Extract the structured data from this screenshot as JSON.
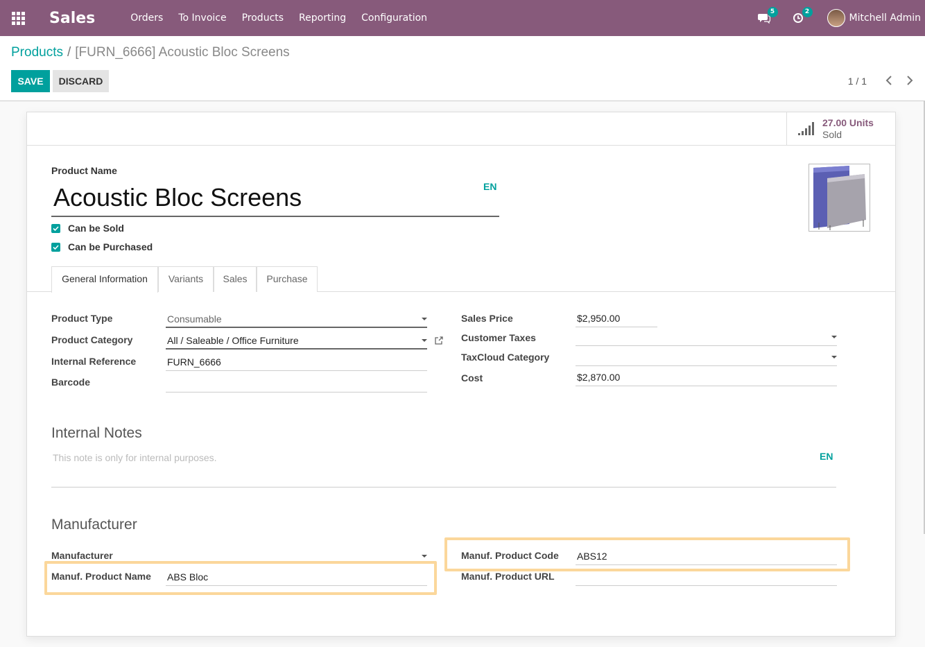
{
  "navbar": {
    "app_name": "Sales",
    "menu": [
      "Orders",
      "To Invoice",
      "Products",
      "Reporting",
      "Configuration"
    ],
    "messages_count": "5",
    "activities_count": "2",
    "user_name": "Mitchell Admin"
  },
  "breadcrumb": {
    "parent": "Products",
    "separator": "/",
    "current": "[FURN_6666] Acoustic Bloc Screens"
  },
  "toolbar": {
    "save_label": "SAVE",
    "discard_label": "DISCARD",
    "pager": "1 / 1"
  },
  "stat": {
    "value": "27.00 Units",
    "label": "Sold"
  },
  "product": {
    "name_label": "Product Name",
    "name": "Acoustic Bloc Screens",
    "lang": "EN",
    "can_be_sold": "Can be Sold",
    "can_be_purchased": "Can be Purchased"
  },
  "tabs": [
    "General Information",
    "Variants",
    "Sales",
    "Purchase"
  ],
  "general": {
    "product_type_label": "Product Type",
    "product_type": "Consumable",
    "product_category_label": "Product Category",
    "product_category": "All / Saleable / Office Furniture",
    "internal_reference_label": "Internal Reference",
    "internal_reference": "FURN_6666",
    "barcode_label": "Barcode",
    "barcode": "",
    "sales_price_label": "Sales Price",
    "sales_price": "$2,950.00",
    "customer_taxes_label": "Customer Taxes",
    "customer_taxes": "",
    "taxcloud_category_label": "TaxCloud Category",
    "taxcloud_category": "",
    "cost_label": "Cost",
    "cost": "$2,870.00"
  },
  "notes": {
    "title": "Internal Notes",
    "placeholder": "This note is only for internal purposes.",
    "lang": "EN"
  },
  "manufacturer": {
    "title": "Manufacturer",
    "manufacturer_label": "Manufacturer",
    "manufacturer": "",
    "product_name_label": "Manuf. Product Name",
    "product_name": "ABS Bloc",
    "product_code_label": "Manuf. Product Code",
    "product_code": "ABS12",
    "product_url_label": "Manuf. Product URL",
    "product_url": ""
  },
  "colors": {
    "navbar": "#875a7b",
    "accent": "#00a09d",
    "highlight": "#fbd79b"
  }
}
